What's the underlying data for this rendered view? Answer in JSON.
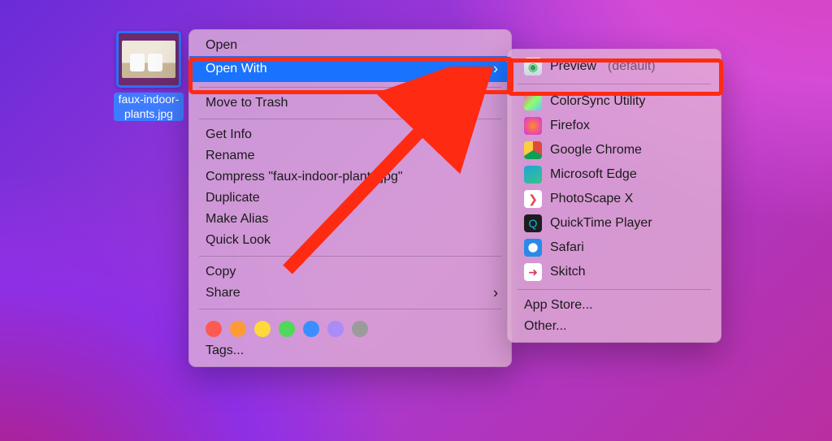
{
  "file": {
    "name": "faux-indoor-plants.jpg"
  },
  "context_menu": {
    "open": "Open",
    "open_with": "Open With",
    "move_to_trash": "Move to Trash",
    "get_info": "Get Info",
    "rename": "Rename",
    "compress": "Compress \"faux-indoor-plants.jpg\"",
    "duplicate": "Duplicate",
    "make_alias": "Make Alias",
    "quick_look": "Quick Look",
    "copy": "Copy",
    "share": "Share",
    "tags": "Tags...",
    "tag_colors": [
      "#ff5953",
      "#ff9a36",
      "#ffd93b",
      "#4fd85a",
      "#3b8eff",
      "#a98cf5",
      "#9b9b9b"
    ]
  },
  "open_with_menu": {
    "default_app": "Preview",
    "default_suffix": "(default)",
    "apps": [
      {
        "name": "ColorSync Utility",
        "bg": "linear-gradient(135deg,#ff5aa3,#8eff6a,#61c7ff)"
      },
      {
        "name": "Firefox",
        "bg": "radial-gradient(circle at 50% 50%, #ff8a2b 0%, #e43fc0 80%)"
      },
      {
        "name": "Google Chrome",
        "bg": "conic-gradient(#dd4b3e 0 33%, #0f9d58 33% 66%, #ffcd41 66% 100%)"
      },
      {
        "name": "Microsoft Edge",
        "bg": "linear-gradient(150deg,#1fa5d8,#36c486)"
      },
      {
        "name": "PhotoScape X",
        "bg": "#ffffff"
      },
      {
        "name": "QuickTime Player",
        "bg": "#1d1d1f"
      },
      {
        "name": "Safari",
        "bg": "radial-gradient(circle,#ffffff 35%, #2a8ae8 38%)"
      },
      {
        "name": "Skitch",
        "bg": "#ffffff"
      }
    ],
    "app_store": "App Store...",
    "other": "Other..."
  }
}
